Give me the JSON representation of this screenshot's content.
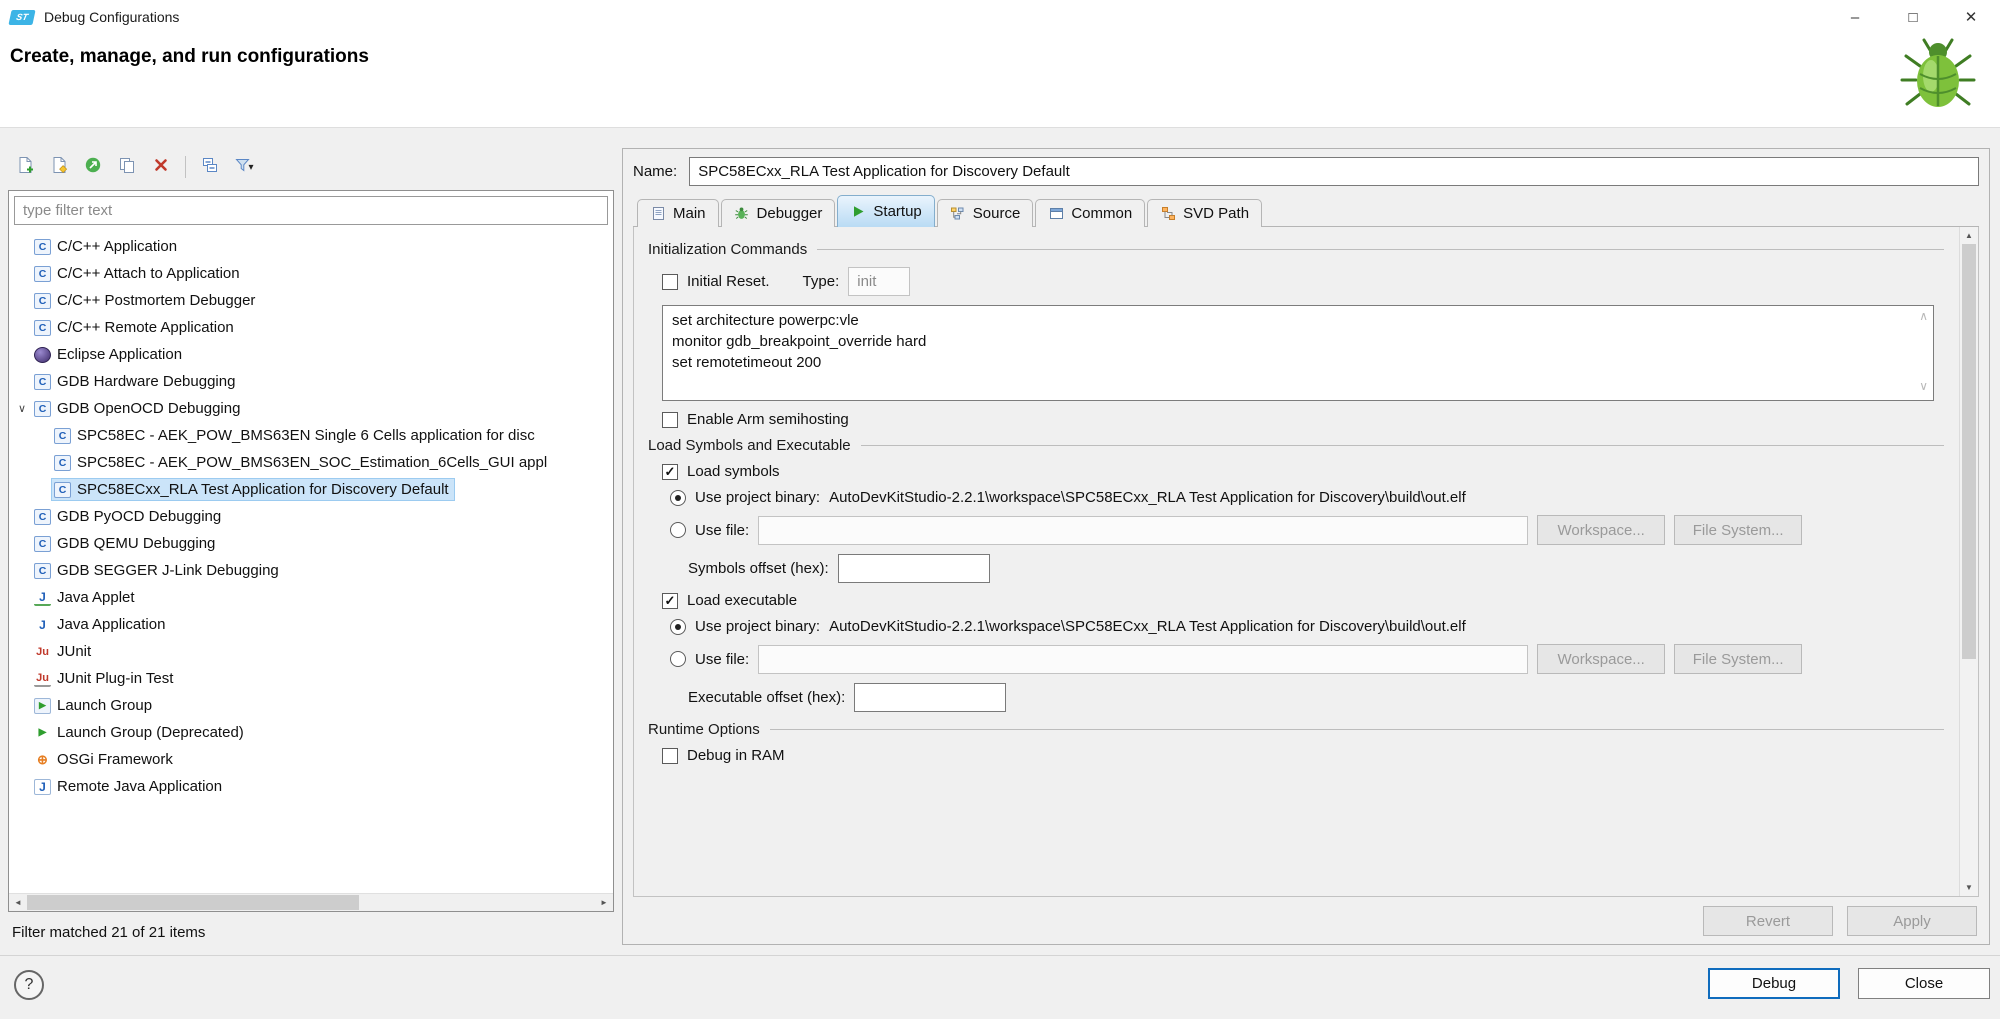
{
  "window": {
    "title": "Debug Configurations",
    "header": "Create, manage, and run configurations"
  },
  "icons": {
    "st_logo": "ST",
    "minimize": "–",
    "maximize": "□",
    "close": "✕",
    "filter_dropdown": "▾",
    "tree_expanded": "∨",
    "scroll_left": "◄",
    "scroll_right": "►",
    "scroll_up": "▲",
    "scroll_down": "▼",
    "textarea_up": "∧",
    "textarea_down": "∨",
    "help": "?"
  },
  "left": {
    "filter_placeholder": "type filter text",
    "status": "Filter matched 21 of 21 items",
    "tree": [
      {
        "label": "C/C++ Application",
        "icon": "c"
      },
      {
        "label": "C/C++ Attach to Application",
        "icon": "c"
      },
      {
        "label": "C/C++ Postmortem Debugger",
        "icon": "c"
      },
      {
        "label": "C/C++ Remote Application",
        "icon": "c"
      },
      {
        "label": "Eclipse Application",
        "icon": "eclipse"
      },
      {
        "label": "GDB Hardware Debugging",
        "icon": "c"
      },
      {
        "label": "GDB OpenOCD Debugging",
        "icon": "c",
        "expanded": true
      },
      {
        "label": "SPC58EC - AEK_POW_BMS63EN Single 6 Cells application for disc",
        "icon": "c",
        "indent": 1
      },
      {
        "label": "SPC58EC - AEK_POW_BMS63EN_SOC_Estimation_6Cells_GUI appl",
        "icon": "c",
        "indent": 1
      },
      {
        "label": "SPC58ECxx_RLA Test Application for Discovery Default",
        "icon": "c",
        "indent": 1,
        "selected": true
      },
      {
        "label": "GDB PyOCD Debugging",
        "icon": "c"
      },
      {
        "label": "GDB QEMU Debugging",
        "icon": "c"
      },
      {
        "label": "GDB SEGGER J-Link Debugging",
        "icon": "c"
      },
      {
        "label": "Java Applet",
        "icon": "applet"
      },
      {
        "label": "Java Application",
        "icon": "java"
      },
      {
        "label": "JUnit",
        "icon": "junit"
      },
      {
        "label": "JUnit Plug-in Test",
        "icon": "junit-plugin"
      },
      {
        "label": "Launch Group",
        "icon": "launch-group"
      },
      {
        "label": "Launch Group (Deprecated)",
        "icon": "launch-group-deprecated"
      },
      {
        "label": "OSGi Framework",
        "icon": "osgi"
      },
      {
        "label": "Remote Java Application",
        "icon": "remote-java"
      }
    ]
  },
  "name_field": {
    "label": "Name:",
    "value": "SPC58ECxx_RLA Test Application for Discovery Default"
  },
  "tabs": [
    {
      "label": "Main",
      "icon": "main"
    },
    {
      "label": "Debugger",
      "icon": "debugger"
    },
    {
      "label": "Startup",
      "icon": "startup",
      "active": true
    },
    {
      "label": "Source",
      "icon": "source"
    },
    {
      "label": "Common",
      "icon": "common"
    },
    {
      "label": "SVD Path",
      "icon": "svd"
    }
  ],
  "startup": {
    "init_section": "Initialization Commands",
    "initial_reset": "Initial Reset.",
    "type_label": "Type:",
    "type_value": "init",
    "commands": "set architecture powerpc:vle\nmonitor gdb_breakpoint_override hard\nset remotetimeout 200",
    "semihosting": "Enable Arm semihosting",
    "load_section": "Load Symbols and Executable",
    "load_symbols": "Load symbols",
    "use_project_binary": "Use project binary:",
    "symbols_binary_path": "AutoDevKitStudio-2.2.1\\workspace\\SPC58ECxx_RLA Test Application for Discovery\\build\\out.elf",
    "use_file": "Use file:",
    "workspace_btn": "Workspace...",
    "filesystem_btn": "File System...",
    "symbols_offset": "Symbols offset (hex):",
    "load_executable": "Load executable",
    "executable_binary_path": "AutoDevKitStudio-2.2.1\\workspace\\SPC58ECxx_RLA Test Application for Discovery\\build\\out.elf",
    "executable_offset": "Executable offset (hex):",
    "runtime_section": "Runtime Options",
    "debug_in_ram": "Debug in RAM"
  },
  "buttons": {
    "revert": "Revert",
    "apply": "Apply",
    "debug": "Debug",
    "close": "Close"
  }
}
